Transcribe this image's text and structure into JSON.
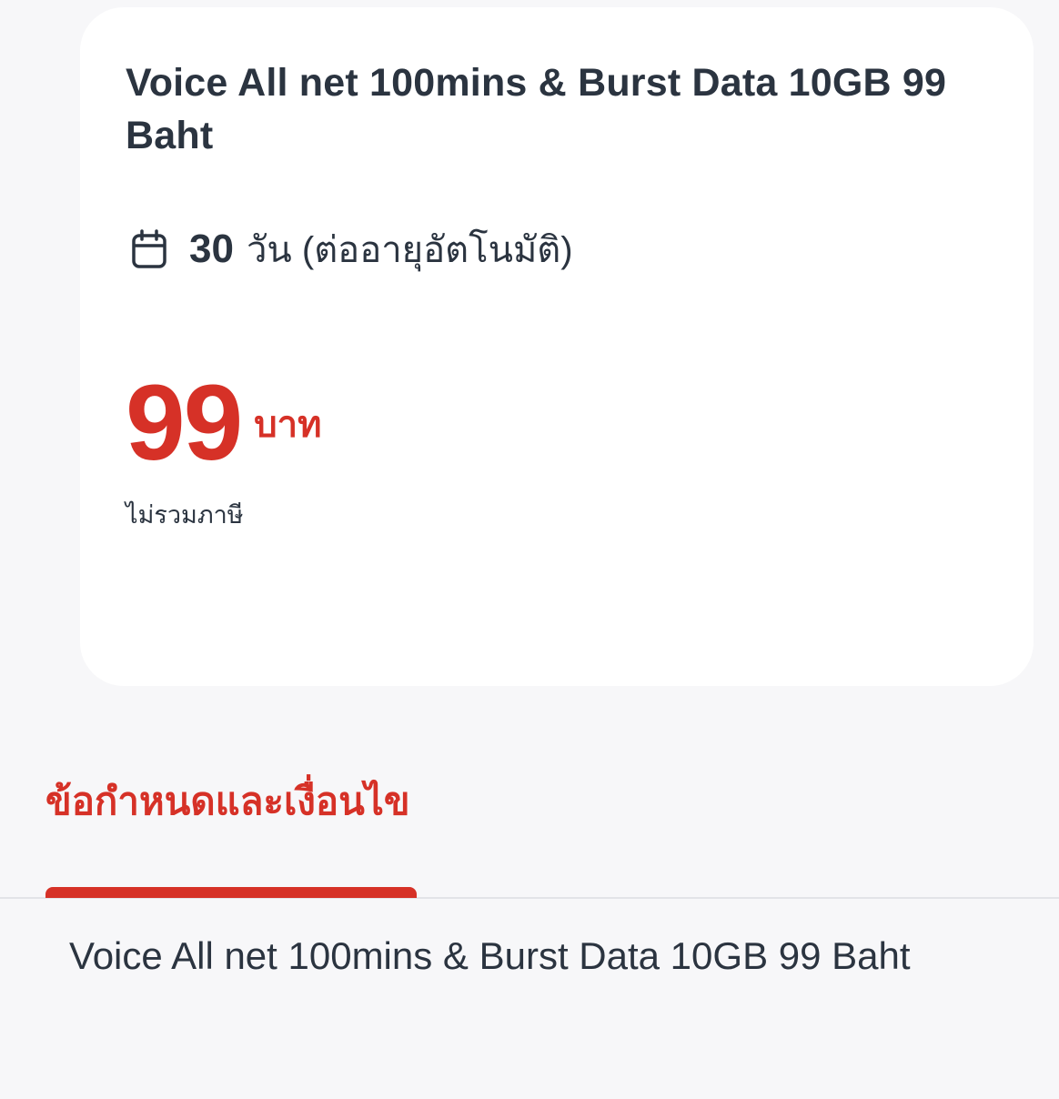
{
  "package": {
    "title": "Voice All net 100mins & Burst Data 10GB 99 Baht",
    "validity_days": "30",
    "validity_text": "วัน (ต่ออายุอัตโนมัติ)",
    "price_value": "99",
    "price_unit": "บาท",
    "tax_note": "ไม่รวมภาษี"
  },
  "tabs": {
    "terms_label": "ข้อกำหนดและเงื่อนไข"
  },
  "terms": {
    "content": "Voice All net 100mins & Burst Data 10GB 99 Baht"
  },
  "colors": {
    "accent": "#d63127",
    "text": "#2b3440",
    "background": "#f7f7f9",
    "card": "#ffffff"
  },
  "icons": {
    "validity": "calendar-icon"
  }
}
